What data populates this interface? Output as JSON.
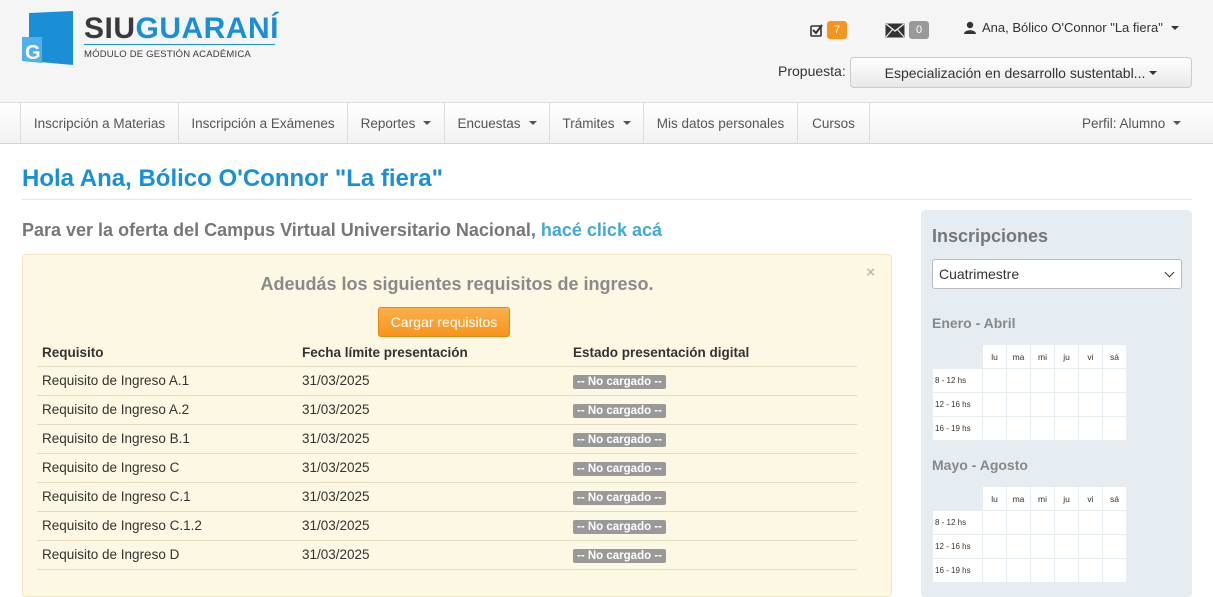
{
  "header": {
    "logo": {
      "title_a": "SIU",
      "title_b": "GUARANÍ",
      "subtitle": "MÓDULO DE GESTIÓN ACADÉMICA",
      "mark_letter": "G"
    },
    "tasks_count": "7",
    "messages_count": "0",
    "user_name": "Ana, Bólico O'Connor \"La fiera\"",
    "propuesta_label": "Propuesta:",
    "propuesta_value": "Especialización en desarrollo sustentabl..."
  },
  "nav": {
    "items": [
      {
        "label": "Inscripción a Materias"
      },
      {
        "label": "Inscripción a Exámenes"
      },
      {
        "label": "Reportes"
      },
      {
        "label": "Encuestas"
      },
      {
        "label": "Trámites"
      },
      {
        "label": "Mis datos personales"
      },
      {
        "label": "Cursos"
      }
    ],
    "perfil": "Perfil: Alumno"
  },
  "main": {
    "greeting": "Hola Ana, Bólico O'Connor \"La fiera\"",
    "campus_text": "Para ver la oferta del Campus Virtual Universitario Nacional,",
    "campus_link": "hacé click acá",
    "alert": {
      "close": "×",
      "title": "Adeudás los siguientes requisitos de ingreso.",
      "button": "Cargar requisitos",
      "columns": [
        "Requisito",
        "Fecha límite presentación",
        "Estado presentación digital"
      ],
      "rows": [
        {
          "req": "Requisito de Ingreso A.1",
          "date": "31/03/2025",
          "status": "-- No cargado --"
        },
        {
          "req": "Requisito de Ingreso A.2",
          "date": "31/03/2025",
          "status": "-- No cargado --"
        },
        {
          "req": "Requisito de Ingreso B.1",
          "date": "31/03/2025",
          "status": "-- No cargado --"
        },
        {
          "req": "Requisito de Ingreso C",
          "date": "31/03/2025",
          "status": "-- No cargado --"
        },
        {
          "req": "Requisito de Ingreso C.1",
          "date": "31/03/2025",
          "status": "-- No cargado --"
        },
        {
          "req": "Requisito de Ingreso C.1.2",
          "date": "31/03/2025",
          "status": "-- No cargado --"
        },
        {
          "req": "Requisito de Ingreso D",
          "date": "31/03/2025",
          "status": "-- No cargado --"
        }
      ]
    }
  },
  "sidebar": {
    "title": "Inscripciones",
    "select_value": "Cuatrimestre",
    "days": [
      "lu",
      "ma",
      "mi",
      "ju",
      "vi",
      "sá"
    ],
    "slots": [
      "8 - 12 hs",
      "12 - 16 hs",
      "16 - 19 hs"
    ],
    "periods": [
      {
        "name": "Enero - Abril"
      },
      {
        "name": "Mayo - Agosto"
      }
    ]
  },
  "colors": {
    "brand_blue": "#1a8fd6",
    "orange": "#f7941d",
    "alert_bg": "#fcf8e3",
    "sidebar_bg": "#e5edf3"
  }
}
